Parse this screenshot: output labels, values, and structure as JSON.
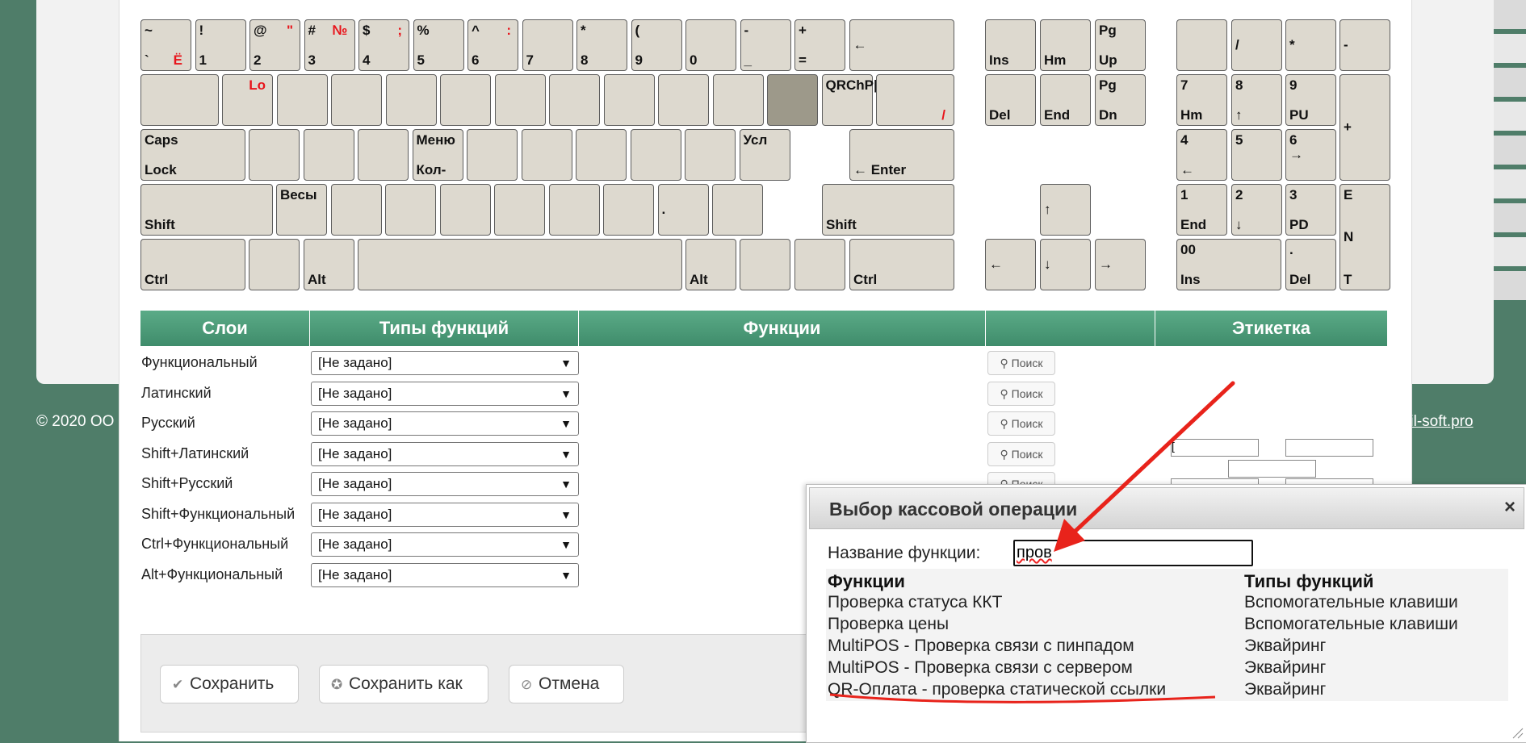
{
  "footer": {
    "copyright": "© 2020 ОО",
    "link": "etail-soft.pro"
  },
  "keyboard": {
    "row1": [
      {
        "top": "~",
        "bot": "`",
        "red_bot": "Ё"
      },
      {
        "top": "!",
        "bot": "1"
      },
      {
        "top": "@",
        "red_top": "\"",
        "bot": "2"
      },
      {
        "top": "#",
        "red_top": "№",
        "bot": "3"
      },
      {
        "top": "$",
        "red_top": ";",
        "bot": "4"
      },
      {
        "top": "%",
        "bot": "5"
      },
      {
        "top": "^",
        "red_top": ":",
        "bot": "6"
      },
      {
        "top": "",
        "bot": "7"
      },
      {
        "top": "*",
        "bot": "8"
      },
      {
        "top": "(",
        "bot": "9"
      },
      {
        "top": "",
        "bot": "0"
      },
      {
        "top": "-",
        "bot": "_"
      },
      {
        "top": "+",
        "bot": "="
      },
      {
        "mid": "←"
      }
    ],
    "row2": [
      {
        "top": ""
      },
      {
        "red_top": "Lo"
      },
      {
        "top": ""
      },
      {
        "top": ""
      },
      {
        "top": ""
      },
      {
        "top": ""
      },
      {
        "top": ""
      },
      {
        "top": ""
      },
      {
        "top": ""
      },
      {
        "top": ""
      },
      {
        "top": ""
      },
      {
        "top": ""
      },
      {
        "top": "QRChP|"
      },
      {
        "red_bot": "/"
      }
    ],
    "row3": [
      {
        "top": "Caps",
        "bot": "Lock"
      },
      {
        "top": ""
      },
      {
        "top": ""
      },
      {
        "top": ""
      },
      {
        "top": "Меню",
        "bot": "Кол-"
      },
      {
        "top": ""
      },
      {
        "top": ""
      },
      {
        "top": ""
      },
      {
        "top": ""
      },
      {
        "top": ""
      },
      {
        "top": "Усл"
      },
      {
        "bot": "← Enter"
      }
    ],
    "row4": [
      {
        "bot": "Shift"
      },
      {
        "top": "Весы"
      },
      {
        "top": ""
      },
      {
        "top": ""
      },
      {
        "top": ""
      },
      {
        "top": ""
      },
      {
        "top": ""
      },
      {
        "top": ""
      },
      {
        "mid": "."
      },
      {
        "top": ""
      },
      {
        "bot": "Shift"
      }
    ],
    "row5": [
      {
        "bot": "Ctrl"
      },
      {
        "top": ""
      },
      {
        "bot": "Alt"
      },
      {
        "top": ""
      },
      {
        "bot": "Alt"
      },
      {
        "top": ""
      },
      {
        "top": ""
      },
      {
        "bot": "Ctrl"
      }
    ],
    "nav": [
      {
        "bot": "Ins"
      },
      {
        "bot": "Hm"
      },
      {
        "top": "Pg",
        "bot": "Up"
      },
      {
        "bot": "Del"
      },
      {
        "bot": "End"
      },
      {
        "top": "Pg",
        "bot": "Dn"
      },
      {
        "mid": "↑"
      },
      {
        "mid": "←"
      },
      {
        "mid": "↓"
      },
      {
        "mid": "→"
      }
    ],
    "numpad": [
      {
        "top": ""
      },
      {
        "mid": "/"
      },
      {
        "mid": "*"
      },
      {
        "mid": "-"
      },
      {
        "top": "7",
        "bot": "Hm"
      },
      {
        "top": "8",
        "bot": "↑"
      },
      {
        "top": "9",
        "bot": "PU"
      },
      {
        "mid": "+"
      },
      {
        "top": "4",
        "bot": "←"
      },
      {
        "top": "5"
      },
      {
        "top": "6",
        "mid2": "→"
      },
      {
        "top": "1",
        "bot": "End"
      },
      {
        "top": "2",
        "bot": "↓"
      },
      {
        "top": "3",
        "bot": "PD"
      },
      {
        "top": "E",
        "mid": "N",
        "bot": "T"
      },
      {
        "top": "00",
        "bot": "Ins"
      },
      {
        "top": ".",
        "bot": "Del"
      }
    ]
  },
  "table": {
    "headers": [
      "Слои",
      "Типы функций",
      "Функции",
      "",
      "Этикетка"
    ],
    "rows": [
      {
        "layer": "Функциональный",
        "type": "[Не задано]",
        "search": "Поиск"
      },
      {
        "layer": "Латинский",
        "type": "[Не задано]",
        "search": "Поиск"
      },
      {
        "layer": "Русский",
        "type": "[Не задано]",
        "search": "Поиск"
      },
      {
        "layer": "Shift+Латинский",
        "type": "[Не задано]",
        "search": "Поиск"
      },
      {
        "layer": "Shift+Русский",
        "type": "[Не задано]",
        "search": "Поиск"
      },
      {
        "layer": "Shift+Функциональный",
        "type": "[Не задано]"
      },
      {
        "layer": "Ctrl+Функциональный",
        "type": "[Не задано]"
      },
      {
        "layer": "Alt+Функциональный",
        "type": "[Не задано]"
      }
    ],
    "label_first_value": "["
  },
  "buttons": {
    "save": "Сохранить",
    "save_as": "Сохранить как",
    "cancel": "Отмена"
  },
  "dialog": {
    "title": "Выбор кассовой операции",
    "close": "×",
    "field_label": "Название функции:",
    "field_value": "пров",
    "col_functions": "Функции",
    "col_types": "Типы функций",
    "results": [
      {
        "fn": "Проверка статуса ККТ",
        "type": "Вспомогательные клавиши"
      },
      {
        "fn": "Проверка цены",
        "type": "Вспомогательные клавиши"
      },
      {
        "fn": "MultiPOS - Проверка связи с пинпадом",
        "type": "Эквайринг"
      },
      {
        "fn": "MultiPOS - Проверка связи с сервером",
        "type": "Эквайринг"
      },
      {
        "fn": "QR-Оплата - проверка статической ссылки",
        "type": "Эквайринг"
      }
    ]
  },
  "colors": {
    "accent_green": "#4f9d7a",
    "annotation_red": "#e8231b",
    "key_bg": "#ddd9cf",
    "active_key": "#9d998a"
  }
}
